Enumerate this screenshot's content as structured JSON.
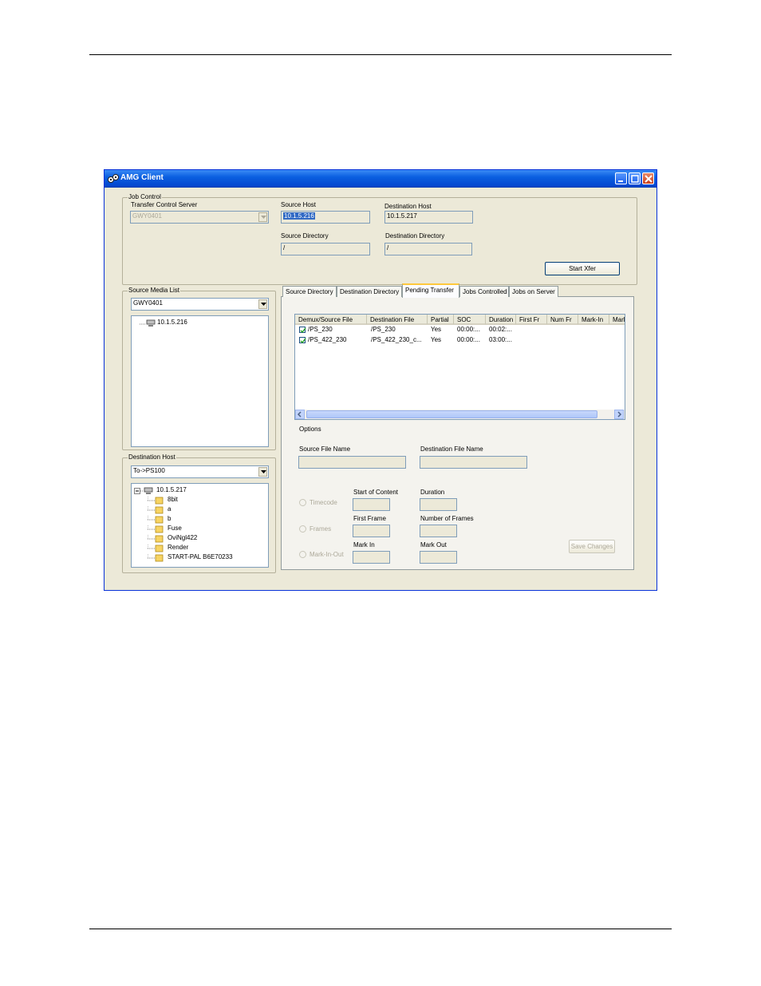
{
  "window": {
    "title": "AMG Client"
  },
  "job_control": {
    "legend": "Job Control",
    "server_label": "Transfer Control Server",
    "server_value": "GWY0401",
    "source_host_label": "Source Host",
    "source_host_value": "10.1.5.216",
    "dest_host_label": "Destination Host",
    "dest_host_value": "10.1.5.217",
    "source_dir_label": "Source Directory",
    "source_dir_value": "/",
    "dest_dir_label": "Destination Directory",
    "dest_dir_value": "/",
    "start_button": "Start Xfer"
  },
  "source_media": {
    "legend": "Source Media List",
    "combo_value": "GWY0401",
    "tree": [
      {
        "label": "10.1.5.216"
      }
    ]
  },
  "destination_host": {
    "legend": "Destination Host",
    "combo_value": "To->PS100",
    "root": "10.1.5.217",
    "folders": [
      "8bit",
      "a",
      "b",
      "Fuse",
      "OviNgl422",
      "Render",
      "START-PAL B6E70233"
    ]
  },
  "tabs": [
    "Source Directory",
    "Destination Directory",
    "Pending Transfer",
    "Jobs Controlled",
    "Jobs on Server"
  ],
  "active_tab": "Pending Transfer",
  "pending": {
    "columns": [
      "Demux/Source File",
      "Destination File",
      "Partial",
      "SOC",
      "Duration",
      "First Fr",
      "Num Fr",
      "Mark-In",
      "Mark"
    ],
    "rows": [
      {
        "source": "/PS_230",
        "dest": "/PS_230",
        "partial": "Yes",
        "soc": "00:00:...",
        "duration": "00:02:..."
      },
      {
        "source": "/PS_422_230",
        "dest": "/PS_422_230_c...",
        "partial": "Yes",
        "soc": "00:00:...",
        "duration": "03:00:..."
      }
    ]
  },
  "options": {
    "title": "Options",
    "source_file_label": "Source File Name",
    "dest_file_label": "Destination File Name",
    "timecode": "Timecode",
    "frames": "Frames",
    "markinout": "Mark-In-Out",
    "start_content": "Start of Content",
    "duration": "Duration",
    "first_frame": "First Frame",
    "num_frames": "Number of Frames",
    "mark_in": "Mark In",
    "mark_out": "Mark Out",
    "save_button": "Save Changes"
  },
  "colors": {
    "titlebar": "#0a5fe0",
    "face": "#ece9d8",
    "selection": "#316ac5"
  }
}
